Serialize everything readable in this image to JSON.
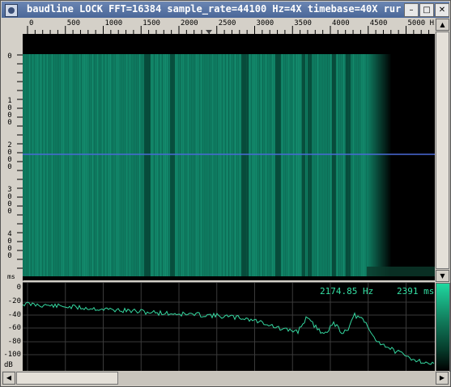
{
  "window": {
    "title": "baudline  LOCK FFT=16384 sample_rate=44100 Hz=4X timebase=40X  rur",
    "buttons": {
      "menu": "≡",
      "minimize": "–",
      "maximize": "□",
      "close": "✕"
    }
  },
  "freq_ruler": {
    "labels": [
      "0",
      "500",
      "1000",
      "1500",
      "2000",
      "2500",
      "3000",
      "3500",
      "4000",
      "4500",
      "5000 Hz"
    ],
    "unit": "Hz"
  },
  "time_ruler": {
    "labels": [
      {
        "digits": [
          "0"
        ]
      },
      {
        "digits": [
          "1",
          "0",
          "0",
          "0"
        ]
      },
      {
        "digits": [
          "2",
          "0",
          "0",
          "0"
        ]
      },
      {
        "digits": [
          "3",
          "0",
          "0",
          "0"
        ]
      },
      {
        "digits": [
          "4",
          "0",
          "0",
          "0"
        ]
      }
    ],
    "unit": "ms"
  },
  "spectrum": {
    "db_labels": [
      "0",
      "-20",
      "-40",
      "-60",
      "-80",
      "-100",
      "dB"
    ],
    "freq_readout": "2174.85 Hz",
    "time_readout": "2391 ms"
  },
  "colors": {
    "accent": "#1fa882",
    "trace": "#35d8a0",
    "background": "#000000",
    "cursor_line": "#4a6ad8"
  },
  "icons": {
    "window": "baudline-app-icon",
    "scroll_up": "arrow-up-icon",
    "scroll_down": "arrow-down-icon",
    "scroll_left": "arrow-left-icon",
    "scroll_right": "arrow-right-icon"
  }
}
